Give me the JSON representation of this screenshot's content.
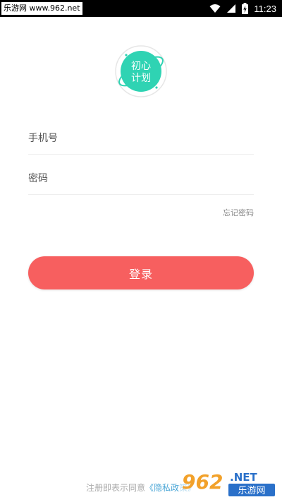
{
  "status_bar": {
    "watermark_text": "乐游网 www.962.net",
    "time": "11:23",
    "icons": [
      "wifi-icon",
      "signal-icon",
      "battery-charging-icon"
    ]
  },
  "logo": {
    "line1": "初心",
    "line2": "计划",
    "color": "#2fd3b3"
  },
  "form": {
    "phone_placeholder": "手机号",
    "password_placeholder": "密码",
    "forgot_label": "忘记密码",
    "login_label": "登录"
  },
  "footer": {
    "prefix": "注册即表示同意",
    "policy_link": "《隐私政策》"
  },
  "watermark": {
    "digits": "962",
    "suffix": ".NET",
    "caption": "乐游网"
  },
  "colors": {
    "accent": "#f75f5f",
    "link": "#4aa6d6",
    "logo": "#2fd3b3"
  }
}
